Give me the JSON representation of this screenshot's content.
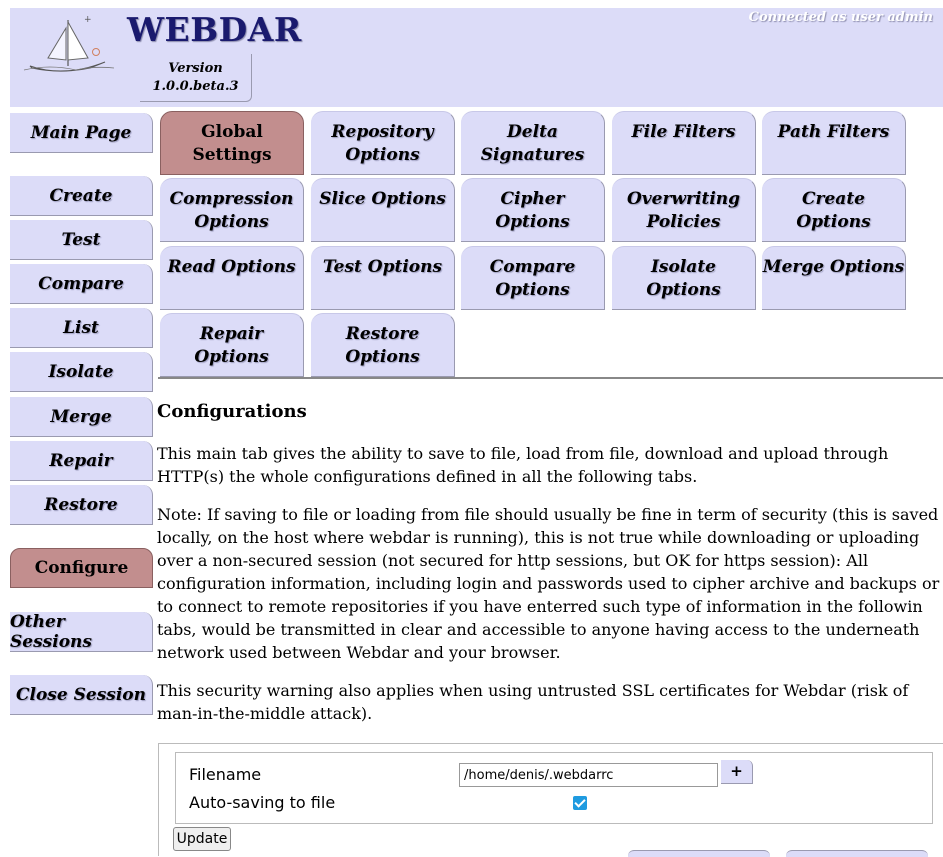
{
  "header": {
    "app_title": "WEBDAR",
    "version_label": "Version",
    "version_number": "1.0.0.beta.3",
    "connection_status": "Connected as user admin"
  },
  "sidebar": {
    "items": [
      {
        "label": "Main Page"
      },
      {
        "label": "Create"
      },
      {
        "label": "Test"
      },
      {
        "label": "Compare"
      },
      {
        "label": "List"
      },
      {
        "label": "Isolate"
      },
      {
        "label": "Merge"
      },
      {
        "label": "Repair"
      },
      {
        "label": "Restore"
      },
      {
        "label": "Configure",
        "active": true
      },
      {
        "label": "Other Sessions"
      },
      {
        "label": "Close Session"
      }
    ]
  },
  "tabs": [
    {
      "line1": "Global Settings",
      "line2": "",
      "active": true
    },
    {
      "line1": "Repository",
      "line2": "Options"
    },
    {
      "line1": "Delta",
      "line2": "Signatures"
    },
    {
      "line1": "File Filters",
      "line2": ""
    },
    {
      "line1": "Path Filters",
      "line2": ""
    },
    {
      "line1": "Compression",
      "line2": "Options"
    },
    {
      "line1": "Slice Options",
      "line2": ""
    },
    {
      "line1": "Cipher Options",
      "line2": ""
    },
    {
      "line1": "Overwriting",
      "line2": "Policies"
    },
    {
      "line1": "Create Options",
      "line2": ""
    },
    {
      "line1": "Read Options",
      "line2": ""
    },
    {
      "line1": "Test Options",
      "line2": ""
    },
    {
      "line1": "Compare",
      "line2": "Options"
    },
    {
      "line1": "Isolate Options",
      "line2": ""
    },
    {
      "line1": "Merge Options",
      "line2": ""
    },
    {
      "line1": "Repair Options",
      "line2": ""
    },
    {
      "line1": "Restore",
      "line2": "Options"
    }
  ],
  "main": {
    "heading": "Configurations",
    "para1": "This main tab gives the ability to save to file, load from file, download and upload through HTTP(s) the whole configurations defined in all the following tabs.",
    "para2": "Note: If saving to file or loading from file should usually be fine in term of security (this is saved locally, on the host where webdar is running), this is not true while downloading or uploading over a non-secured session (not secured for http sessions, but OK for https session): All configuration information, including login and passwords used to cipher archive and backups or to connect to remote repositories if you have enterred such type of information in the followin tabs, would be transmitted in clear and accessible to anyone having access to the underneath network used between Webdar and your browser.",
    "para3": "This security warning also applies when using untrusted SSL certificates for Webdar (risk of man-in-the-middle attack)."
  },
  "form": {
    "filename_label": "Filename",
    "filename_value": "/home/denis/.webdarrc",
    "plus_label": "+",
    "autosave_label": "Auto-saving to file",
    "autosave_checked": true,
    "update_label": "Update"
  },
  "colors": {
    "panel": "#dcdcf8",
    "active": "#c28e8e",
    "title": "#1a1a6e",
    "checkbox": "#1f9be0"
  }
}
